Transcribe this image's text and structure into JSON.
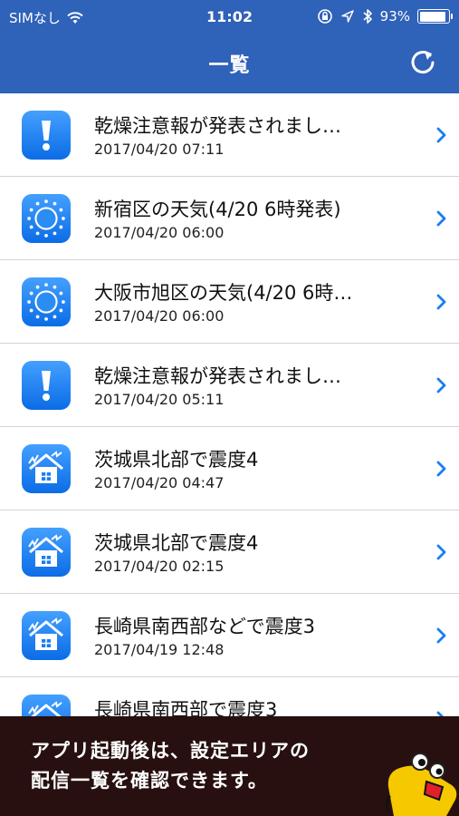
{
  "status_bar": {
    "carrier": "SIMなし",
    "time": "11:02",
    "battery": "93%",
    "battery_level": 0.93,
    "icons": [
      "wifi-icon",
      "lock-rotation-icon",
      "location-icon",
      "bluetooth-icon",
      "battery-icon"
    ]
  },
  "nav": {
    "title": "一覧",
    "refresh_icon": "refresh-icon"
  },
  "items": [
    {
      "icon": "alert-icon",
      "title": "乾燥注意報が発表されまし…",
      "date": "2017/04/20 07:11"
    },
    {
      "icon": "sun-icon",
      "title": "新宿区の天気(4/20 6時発表)",
      "date": "2017/04/20 06:00"
    },
    {
      "icon": "sun-icon",
      "title": "大阪市旭区の天気(4/20 6時…",
      "date": "2017/04/20 06:00"
    },
    {
      "icon": "alert-icon",
      "title": "乾燥注意報が発表されまし…",
      "date": "2017/04/20 05:11"
    },
    {
      "icon": "earthquake-icon",
      "title": "茨城県北部で震度4",
      "date": "2017/04/20 04:47"
    },
    {
      "icon": "earthquake-icon",
      "title": "茨城県北部で震度4",
      "date": "2017/04/20 02:15"
    },
    {
      "icon": "earthquake-icon",
      "title": "長崎県南西部などで震度3",
      "date": "2017/04/19 12:48"
    },
    {
      "icon": "earthquake-icon",
      "title": "長崎県南西部で震度3",
      "date": ""
    }
  ],
  "banner": {
    "text": "アプリ起動後は、設定エリアの\n配信一覧を確認できます。",
    "mascot_icon": "mascot-icon"
  },
  "colors": {
    "header": "#2f62b9",
    "icon_blue": "#1a7ef0",
    "chevron": "#1a7ef0",
    "banner": "#281010",
    "mascot": "#f5c800"
  }
}
